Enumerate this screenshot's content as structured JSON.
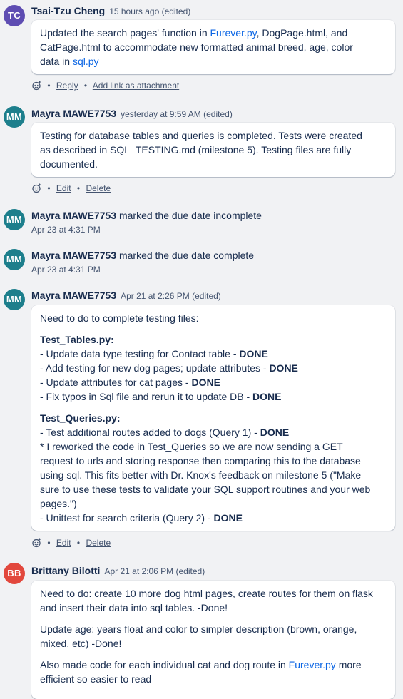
{
  "colors": {
    "tc": "#5e4db2",
    "mm": "#1d7f8c",
    "bb": "#e2483d",
    "link": "#0c66e4"
  },
  "entries": [
    {
      "initials": "TC",
      "author": "Tsai-Tzu Cheng",
      "meta": "15 hours ago (edited)",
      "body": {
        "l1a": "Updated the search pages' function in ",
        "l1link": "Furever.py",
        "l1b": ", DogPage.html, and",
        "l2": "CatPage.html to accommodate new formatted animal breed, age, color",
        "l3a": "data in ",
        "l3link": "sql.py"
      },
      "actions": [
        "Reply",
        "Add link as attachment"
      ]
    },
    {
      "initials": "MM",
      "author": "Mayra MAWE7753",
      "meta": "yesterday at 9:59 AM (edited)",
      "body": {
        "l1": "Testing for database tables and queries is completed. Tests were created",
        "l2": "as described in SQL_TESTING.md (milestone 5). Testing files are fully",
        "l3": "documented."
      },
      "actions": [
        "Edit",
        "Delete"
      ]
    },
    {
      "initials": "MM",
      "author": "Mayra MAWE7753",
      "action": "marked the due date incomplete",
      "date": "Apr 23 at 4:31 PM"
    },
    {
      "initials": "MM",
      "author": "Mayra MAWE7753",
      "action": "marked the due date complete",
      "date": "Apr 23 at 4:31 PM"
    },
    {
      "initials": "MM",
      "author": "Mayra MAWE7753",
      "meta": "Apr 21 at 2:26 PM (edited)",
      "body": {
        "intro": "Need to do to complete testing files:",
        "h1": "Test_Tables.py:",
        "t1": [
          "- Update data type testing for Contact table - ",
          "- Add testing for new dog pages; update attributes - ",
          "- Update attributes for cat pages - ",
          "- Fix typos in Sql file and rerun it to update DB - "
        ],
        "done": "DONE",
        "h2": "Test_Queries.py:",
        "q1": "- Test additional routes added to dogs (Query 1) - ",
        "n1": "* I reworked the code in Test_Queries so we are now sending a GET",
        "n2": "request to urls and storing response then comparing this to the database",
        "n3": "using sql. This fits better with Dr. Knox's feedback on milestone 5 (\"Make",
        "n4": "sure to use these tests to validate your SQL support routines and your web",
        "n5": "pages.\")",
        "q2": "- Unittest for search criteria (Query 2) - "
      },
      "actions": [
        "Edit",
        "Delete"
      ]
    },
    {
      "initials": "BB",
      "author": "Brittany Bilotti",
      "meta": "Apr 21 at 2:06 PM (edited)",
      "body": {
        "p1a": "Need to do: create 10 more dog html pages, create routes for them on flask",
        "p1b": "and insert their data into sql tables. -Done!",
        "p2a": "Update age: years float and color to simpler description (brown, orange,",
        "p2b": "mixed, etc) -Done!",
        "p3a": "Also made code for each individual cat and dog route in ",
        "p3link": "Furever.py",
        "p3b": " more",
        "p3c": "efficient so easier to read"
      }
    }
  ]
}
